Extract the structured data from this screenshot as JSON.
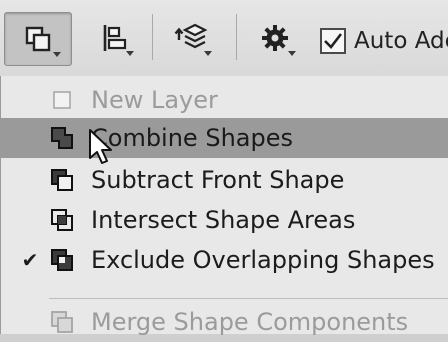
{
  "toolbar": {
    "buttons": [
      {
        "icon": "path-operations-icon"
      },
      {
        "icon": "path-alignment-icon"
      },
      {
        "icon": "path-arrangement-icon"
      },
      {
        "icon": "gear-icon"
      }
    ],
    "auto_add_label": "Auto Adc",
    "auto_add_checked": true
  },
  "menu": {
    "items": [
      {
        "label": "New Layer",
        "icon": "new-layer-icon",
        "disabled": true,
        "checked": false
      },
      {
        "label": "Combine Shapes",
        "icon": "combine-shapes-icon",
        "highlighted": true,
        "checked": false
      },
      {
        "label": "Subtract Front Shape",
        "icon": "subtract-front-shape-icon",
        "checked": false
      },
      {
        "label": "Intersect Shape Areas",
        "icon": "intersect-shape-areas-icon",
        "checked": false
      },
      {
        "label": "Exclude Overlapping Shapes",
        "icon": "exclude-overlapping-shapes-icon",
        "checked": true,
        "check_glyph": "✔"
      },
      {
        "label": "Merge Shape Components",
        "icon": "merge-shape-components-icon",
        "disabled": true,
        "checked": false
      }
    ]
  },
  "colors": {
    "highlight": "#9a9a9a",
    "menu_bg": "#e8e8e8",
    "disabled_text": "#9b9b9b"
  }
}
